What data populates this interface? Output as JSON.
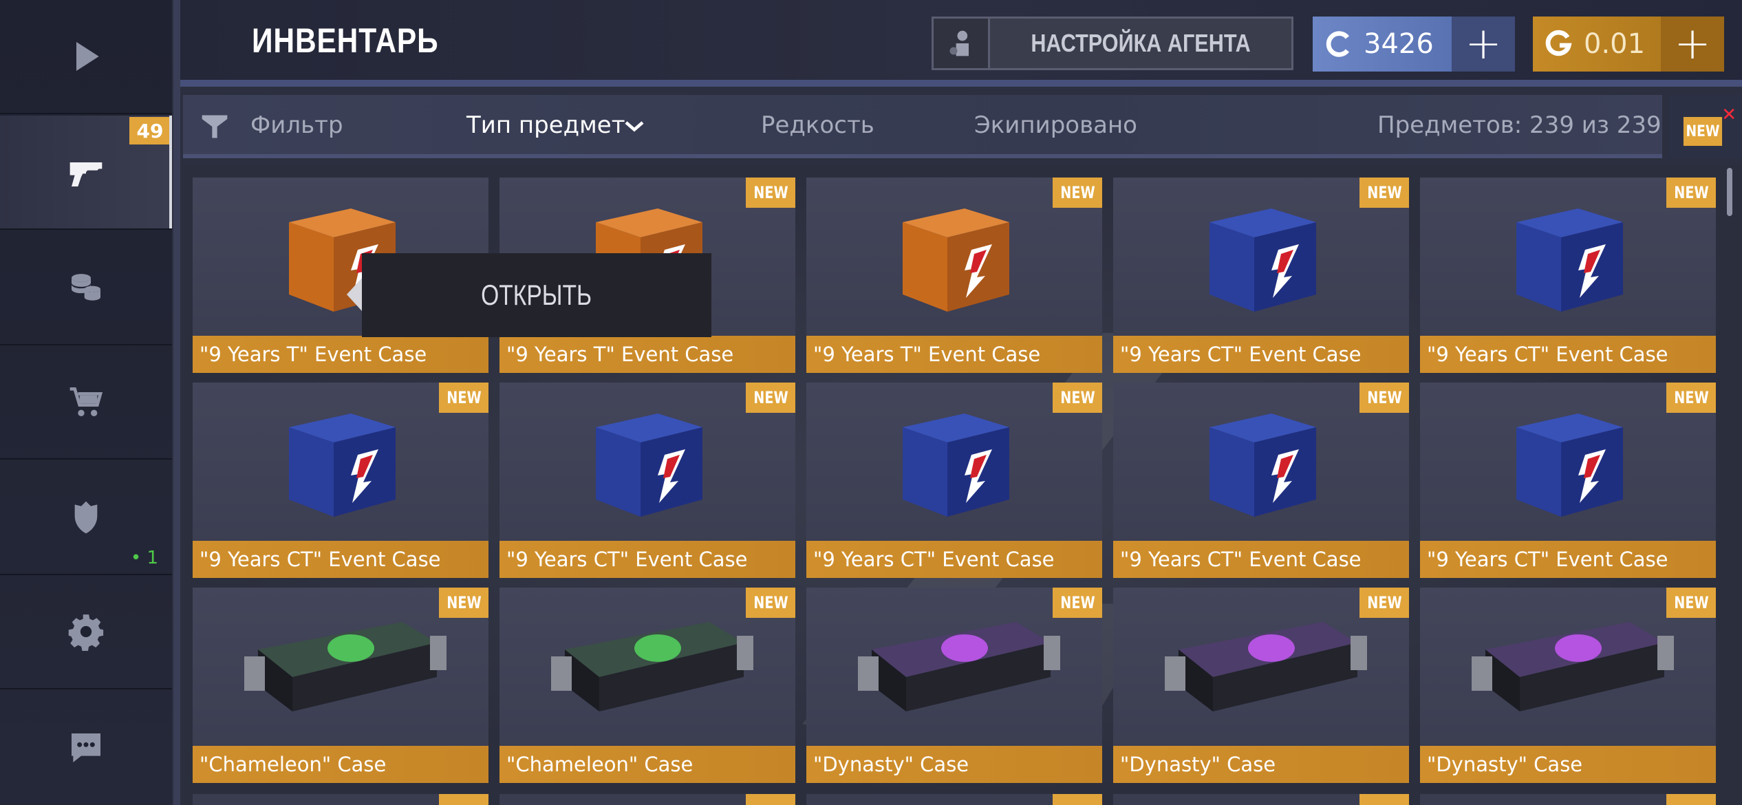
{
  "sidebar": {
    "items": [
      {
        "name": "play",
        "icon": "play-icon"
      },
      {
        "name": "inventory",
        "icon": "pistol-icon",
        "badge": "49",
        "active": true
      },
      {
        "name": "coins",
        "icon": "coins-icon"
      },
      {
        "name": "shop",
        "icon": "cart-icon"
      },
      {
        "name": "clan",
        "icon": "shield-icon",
        "count": "• 1"
      },
      {
        "name": "settings",
        "icon": "gear-icon"
      },
      {
        "name": "chat",
        "icon": "chat-icon"
      }
    ]
  },
  "header": {
    "title": "ИНВЕНТАРЬ",
    "agent_button": "НАСТРОЙКА АГЕНТА",
    "credits": "3426",
    "gold": "0.01",
    "plus": "+"
  },
  "filter": {
    "filter_label": "Фильтр",
    "type_label": "Тип предмет",
    "rarity_label": "Редкость",
    "equipped_label": "Экипировано",
    "count_label": "Предметов: 239 из 239",
    "new_label": "NEW",
    "close": "✕"
  },
  "context_menu": {
    "open_label": "ОТКРЫТЬ"
  },
  "new_tag": "NEW",
  "items": [
    {
      "name": "\"9 Years T\" Event Case",
      "kind": "orange-box",
      "is_new": false
    },
    {
      "name": "\"9 Years T\" Event Case",
      "kind": "orange-box",
      "is_new": true
    },
    {
      "name": "\"9 Years T\" Event Case",
      "kind": "orange-box",
      "is_new": true
    },
    {
      "name": "\"9 Years CT\" Event Case",
      "kind": "blue-box",
      "is_new": true
    },
    {
      "name": "\"9 Years CT\" Event Case",
      "kind": "blue-box",
      "is_new": true
    },
    {
      "name": "\"9 Years CT\" Event Case",
      "kind": "blue-box",
      "is_new": true
    },
    {
      "name": "\"9 Years CT\" Event Case",
      "kind": "blue-box",
      "is_new": true
    },
    {
      "name": "\"9 Years CT\" Event Case",
      "kind": "blue-box",
      "is_new": true
    },
    {
      "name": "\"9 Years CT\" Event Case",
      "kind": "blue-box",
      "is_new": true
    },
    {
      "name": "\"9 Years CT\" Event Case",
      "kind": "blue-box",
      "is_new": true
    },
    {
      "name": "\"Chameleon\" Case",
      "kind": "chameleon-case",
      "is_new": true
    },
    {
      "name": "\"Chameleon\" Case",
      "kind": "chameleon-case",
      "is_new": true
    },
    {
      "name": "\"Dynasty\" Case",
      "kind": "dynasty-case",
      "is_new": true
    },
    {
      "name": "\"Dynasty\" Case",
      "kind": "dynasty-case",
      "is_new": true
    },
    {
      "name": "\"Dynasty\" Case",
      "kind": "dynasty-case",
      "is_new": true
    }
  ],
  "colors": {
    "accent_gold": "#e1a53b",
    "name_bar": "#d08f2c",
    "credits_blue": "#6c86c6"
  }
}
